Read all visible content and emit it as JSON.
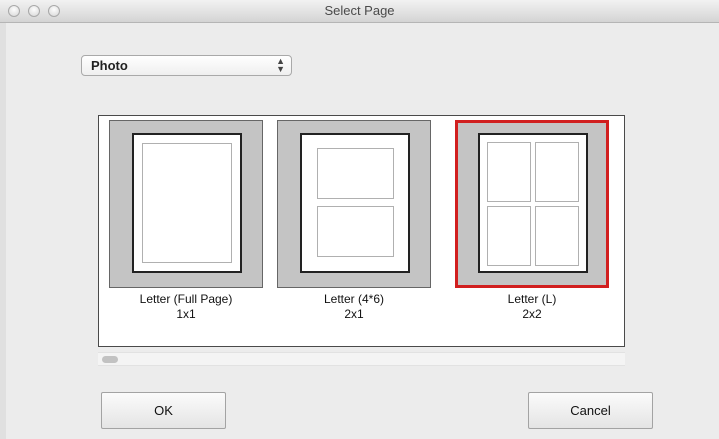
{
  "window": {
    "title": "Select Page"
  },
  "category_select": {
    "value": "Photo",
    "arrows": "▲▼"
  },
  "layouts": [
    {
      "name": "Letter (Full Page)",
      "grid": "1x1",
      "selected": false
    },
    {
      "name": "Letter (4*6)",
      "grid": "2x1",
      "selected": false
    },
    {
      "name": "Letter (L)",
      "grid": "2x2",
      "selected": true
    }
  ],
  "colors": {
    "selection_border": "#d11f1f",
    "thumbnail_bg": "#c4c4c4"
  },
  "buttons": {
    "ok": "OK",
    "cancel": "Cancel"
  }
}
